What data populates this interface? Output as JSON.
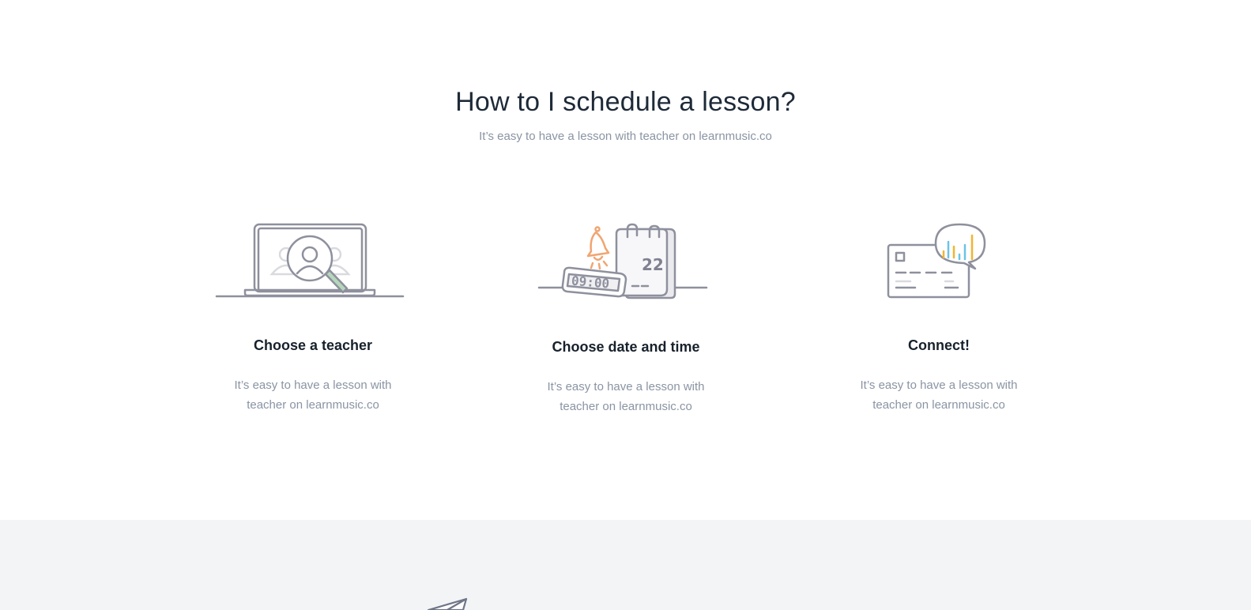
{
  "section": {
    "title": "How to I schedule a lesson?",
    "subtitle": "It’s easy to have a lesson with teacher on learnmusic.co"
  },
  "steps": [
    {
      "icon": "laptop-search-icon",
      "title": "Choose a teacher",
      "description": "It’s easy to have a lesson with teacher on learnmusic.co"
    },
    {
      "icon": "calendar-clock-icon",
      "title": "Choose date and time",
      "description": "It’s easy to have a lesson with teacher on learnmusic.co",
      "clock_text": "09:00",
      "calendar_day": "22"
    },
    {
      "icon": "card-chat-icon",
      "title": "Connect!",
      "description": "It’s easy to have a lesson with teacher on learnmusic.co"
    }
  ],
  "footer_band": {
    "icon": "paper-plane-icon"
  },
  "colors": {
    "line": "#8e909d",
    "accent_orange": "#f0a572",
    "accent_yellow": "#f2b431",
    "accent_blue": "#6cc3e8",
    "band_bg": "#f3f4f6"
  }
}
